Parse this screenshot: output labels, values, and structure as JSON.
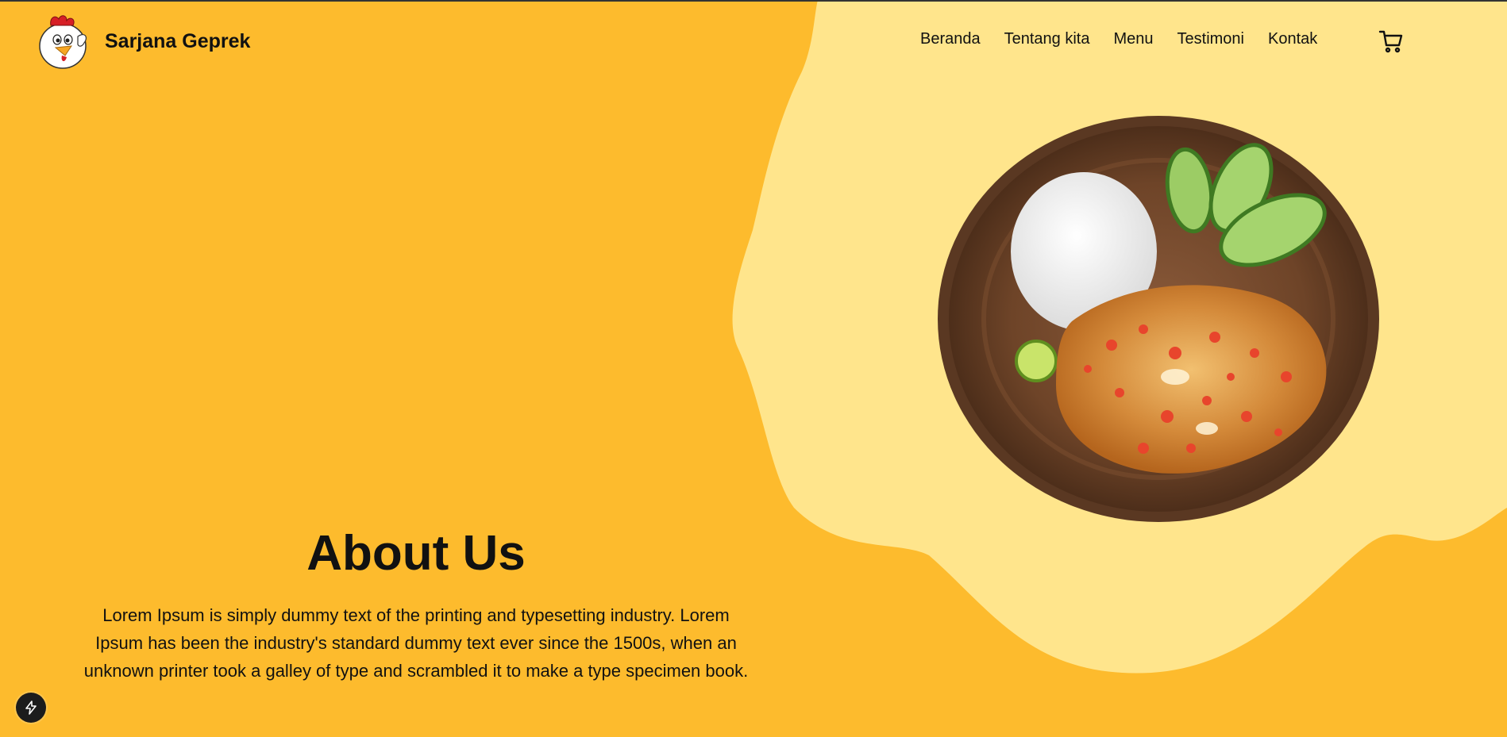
{
  "brand": {
    "name": "Sarjana Geprek",
    "logo_icon": "rooster-mascot-logo"
  },
  "nav": {
    "items": [
      {
        "label": "Beranda"
      },
      {
        "label": "Tentang kita"
      },
      {
        "label": "Menu"
      },
      {
        "label": "Testimoni"
      },
      {
        "label": "Kontak"
      }
    ],
    "cart_icon": "shopping-cart-icon"
  },
  "hero": {
    "image_subject": "ayam-geprek-plate-with-rice-cucumber-lime"
  },
  "about": {
    "title": "About Us",
    "text": "Lorem Ipsum is simply dummy text of the printing and typesetting industry. Lorem Ipsum has been the industry's standard dummy text ever since the 1500s, when an unknown printer took a galley of type and scrambled it to make a type specimen book."
  },
  "floating_button": {
    "icon": "lightning-bolt-icon"
  },
  "colors": {
    "background": "#FDBB2D",
    "blob": "#FFE58C",
    "text": "#111111"
  }
}
